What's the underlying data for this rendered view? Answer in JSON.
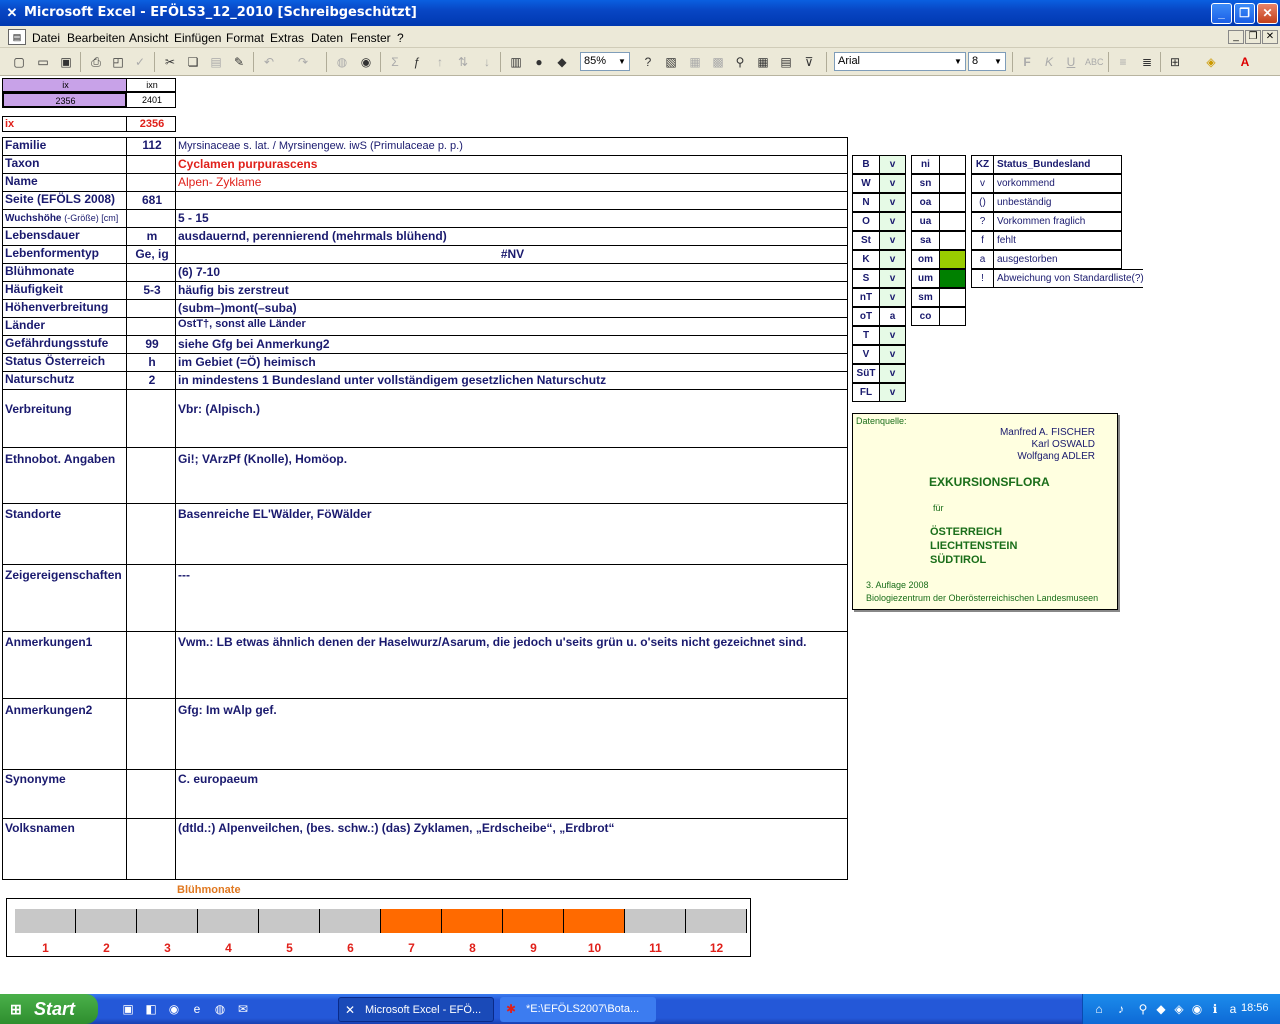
{
  "window": {
    "title": "Microsoft Excel - EFÖLS3_12_2010  [Schreibgeschützt]"
  },
  "menu": {
    "items": [
      "Datei",
      "Bearbeiten",
      "Ansicht",
      "Einfügen",
      "Format",
      "Extras",
      "Daten",
      "Fenster",
      "?"
    ]
  },
  "toolbar": {
    "zoom": "85%",
    "font": "Arial",
    "size": "8"
  },
  "index": {
    "h1": "ix",
    "h2": "ixn",
    "v1": "2356",
    "v2": "2401",
    "ix_label": "ix",
    "ix_value": "2356"
  },
  "rows": [
    {
      "label": "Familie",
      "code": "112",
      "value": "Myrsinaceae s. lat.  /  Myrsinengew. iwS (Primulaceae p. p.)"
    },
    {
      "label": "Taxon",
      "code": "",
      "value": "Cyclamen purpurascens"
    },
    {
      "label": "Name",
      "code": "",
      "value": "Alpen- Zyklame"
    },
    {
      "label": "Seite (EFÖLS 2008)",
      "code": "681",
      "value": ""
    },
    {
      "label": "Wuchshöhe",
      "label_suffix": "(-Größe) [cm]",
      "code": "",
      "value": " 5 - 15"
    },
    {
      "label": "Lebensdauer",
      "code": "m",
      "value": "ausdauernd, perennierend (mehrmals blühend)"
    },
    {
      "label": "Lebenformentyp",
      "code": "Ge, ig",
      "value": "#NV"
    },
    {
      "label": "Blühmonate",
      "code": "",
      "value": "(6) 7-10"
    },
    {
      "label": "Häufigkeit",
      "code": "5-3",
      "value": "häufig bis zerstreut"
    },
    {
      "label": "Höhenverbreitung",
      "code": "",
      "value": "(subm–)mont(–suba)"
    },
    {
      "label": "Länder",
      "code": "",
      "value": " OstT†, sonst alle Länder"
    },
    {
      "label": "Gefährdungsstufe",
      "code": "99",
      "value": "siehe Gfg bei Anmerkung2"
    },
    {
      "label": "Status Österreich",
      "code": "h",
      "value": "im Gebiet (=Ö) heimisch"
    },
    {
      "label": "Naturschutz",
      "code": "2",
      "value": "in mindestens 1 Bundesland unter vollständigem gesetzlichen Naturschutz"
    },
    {
      "label": "Verbreitung",
      "code": "",
      "value": "Vbr: (Alpisch.)"
    },
    {
      "label": "Ethnobot. Angaben",
      "code": "",
      "value": "Gi!; VArzPf (Knolle), Homöop."
    },
    {
      "label": "Standorte",
      "code": "",
      "value": "Basenreiche EL'Wälder, FöWälder"
    },
    {
      "label": "Zeigereigenschaften",
      "code": "",
      "value": "---"
    },
    {
      "label": "Anmerkungen1",
      "code": "",
      "value": "Vwm.: LB etwas ähnlich denen der Haselwurz/Asarum, die jedoch u'seits grün u. o'seits nicht gezeichnet sind."
    },
    {
      "label": "Anmerkungen2",
      "code": "",
      "value": "Gfg: Im wAlp gef."
    },
    {
      "label": "Synonyme",
      "code": "",
      "value": "C. europaeum"
    },
    {
      "label": "Volksnamen",
      "code": "",
      "value": "(dtld.:) Alpenveilchen,   (bes. schw.:) (das) Zyklamen, „Erdscheibe“, „Erdbrot“"
    }
  ],
  "states": [
    {
      "k": "B",
      "v": "v"
    },
    {
      "k": "W",
      "v": "v"
    },
    {
      "k": "N",
      "v": "v"
    },
    {
      "k": "O",
      "v": "v"
    },
    {
      "k": "St",
      "v": "v"
    },
    {
      "k": "K",
      "v": "v"
    },
    {
      "k": "S",
      "v": "v"
    },
    {
      "k": "nT",
      "v": "v"
    },
    {
      "k": "oT",
      "v": "a"
    },
    {
      "k": "T",
      "v": "v"
    },
    {
      "k": "V",
      "v": "v"
    },
    {
      "k": "SüT",
      "v": "v"
    },
    {
      "k": "FL",
      "v": "v"
    }
  ],
  "zones": [
    "ni",
    "sn",
    "oa",
    "ua",
    "sa",
    "om",
    "um",
    "sm",
    "co"
  ],
  "zone_colors": {
    "om": "#99cc00",
    "um": "#008000"
  },
  "legend": {
    "h1": "KZ",
    "h2": "Status_Bundesland",
    "items": [
      {
        "k": "v",
        "t": "vorkommend"
      },
      {
        "k": "()",
        "t": "unbeständig"
      },
      {
        "k": "?",
        "t": "Vorkommen fraglich"
      },
      {
        "k": "f",
        "t": "fehlt"
      },
      {
        "k": "a",
        "t": "ausgestorben"
      },
      {
        "k": "!",
        "t": "Abweichung von Standardliste(?)"
      }
    ]
  },
  "source": {
    "label": "Datenquelle:",
    "a1": "Manfred A. FISCHER",
    "a2": "Karl OSWALD",
    "a3": "Wolfgang ADLER",
    "title": "EXKURSIONSFLORA",
    "fuer": "für",
    "c1": "ÖSTERREICH",
    "c2": "LIECHTENSTEIN",
    "c3": "SÜDTIROL",
    "ed": "3. Auflage 2008",
    "pub": "Biologiezentrum der Oberösterreichischen Landesmuseen"
  },
  "bloom": {
    "title": "Blühmonate",
    "months": [
      "1",
      "2",
      "3",
      "4",
      "5",
      "6",
      "7",
      "8",
      "9",
      "10",
      "11",
      "12"
    ],
    "active": [
      7,
      8,
      9,
      10
    ],
    "active_color": "#ff6a00",
    "inactive_color": "#c8c8c8"
  },
  "taskbar": {
    "start": "Start",
    "t1": "Microsoft Excel - EFÖ...",
    "t2": "*E:\\EFÖLS2007\\Bota...",
    "clock": "18:56"
  }
}
